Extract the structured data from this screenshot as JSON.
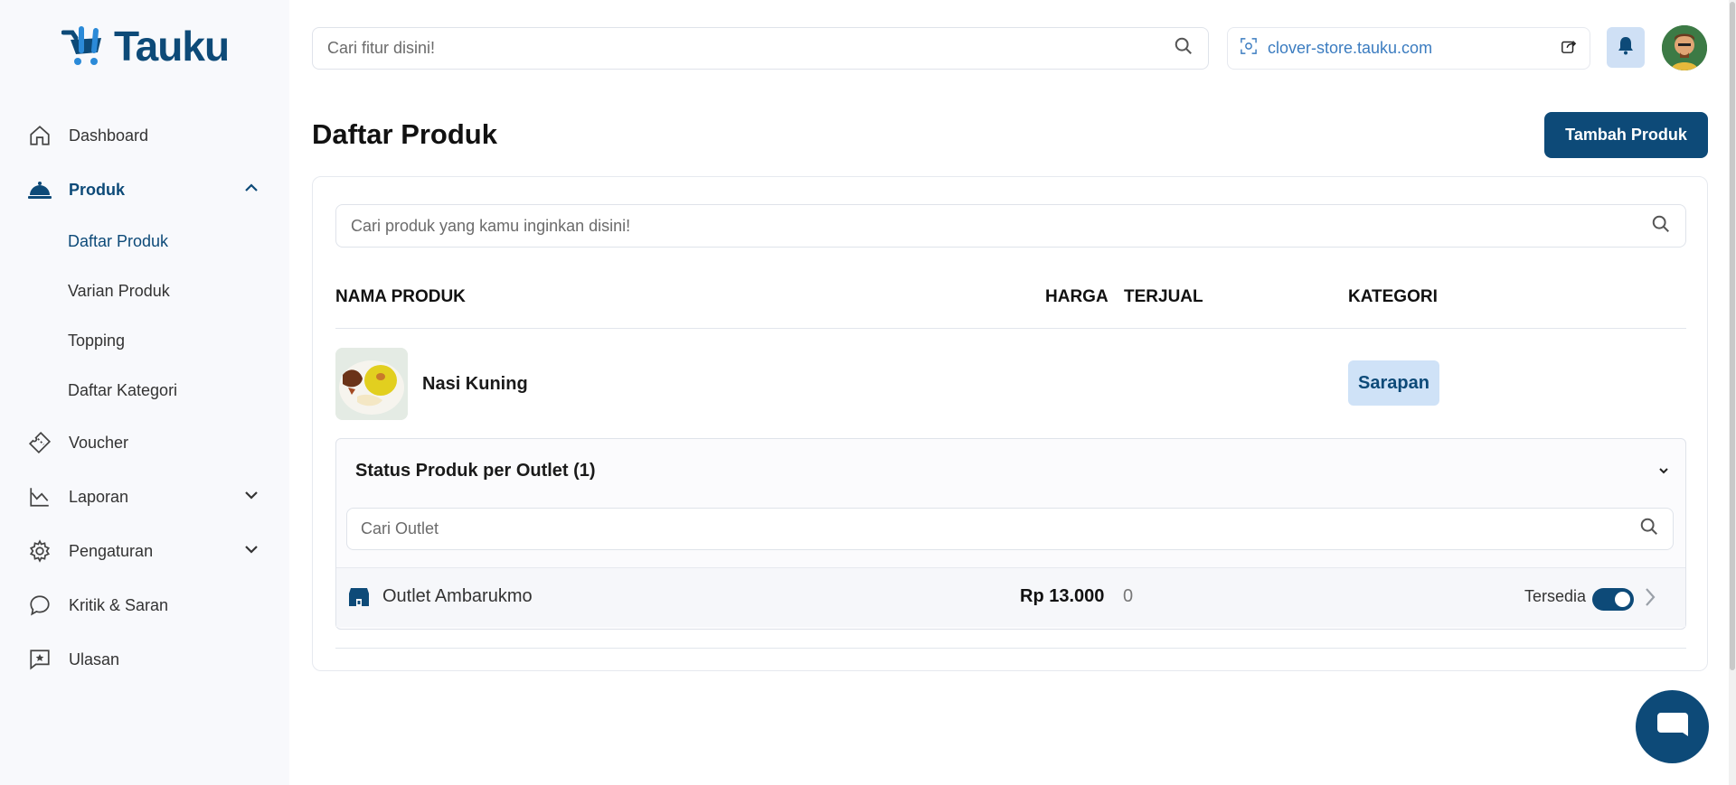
{
  "app": {
    "name": "Tauku"
  },
  "sidebar": {
    "items": [
      {
        "label": "Dashboard",
        "icon": "home-icon"
      },
      {
        "label": "Produk",
        "icon": "cloche-icon",
        "expanded": true,
        "children": [
          "Daftar Produk",
          "Varian Produk",
          "Topping",
          "Daftar Kategori"
        ]
      },
      {
        "label": "Voucher",
        "icon": "ticket-icon"
      },
      {
        "label": "Laporan",
        "icon": "chart-icon"
      },
      {
        "label": "Pengaturan",
        "icon": "gear-icon"
      },
      {
        "label": "Kritik & Saran",
        "icon": "chat-icon"
      },
      {
        "label": "Ulasan",
        "icon": "star-message-icon"
      }
    ]
  },
  "topbar": {
    "search_placeholder": "Cari fitur disini!",
    "store_url": "clover-store.tauku.com"
  },
  "page": {
    "title": "Daftar Produk",
    "add_button": "Tambah Produk"
  },
  "product_search_placeholder": "Cari produk yang kamu inginkan disini!",
  "table": {
    "headers": {
      "name": "NAMA PRODUK",
      "price": "HARGA",
      "sold": "TERJUAL",
      "category": "KATEGORI"
    },
    "rows": [
      {
        "name": "Nasi Kuning",
        "category": "Sarapan",
        "outlet_panel": {
          "title": "Status Produk per Outlet (1)",
          "search_placeholder": "Cari Outlet",
          "outlets": [
            {
              "name": "Outlet Ambarukmo",
              "price": "Rp 13.000",
              "sold": "0",
              "status_label": "Tersedia",
              "available": true
            }
          ]
        }
      }
    ]
  },
  "colors": {
    "primary": "#0d4a78",
    "badge_bg": "#cfe2f7",
    "link": "#3b7cc0"
  }
}
